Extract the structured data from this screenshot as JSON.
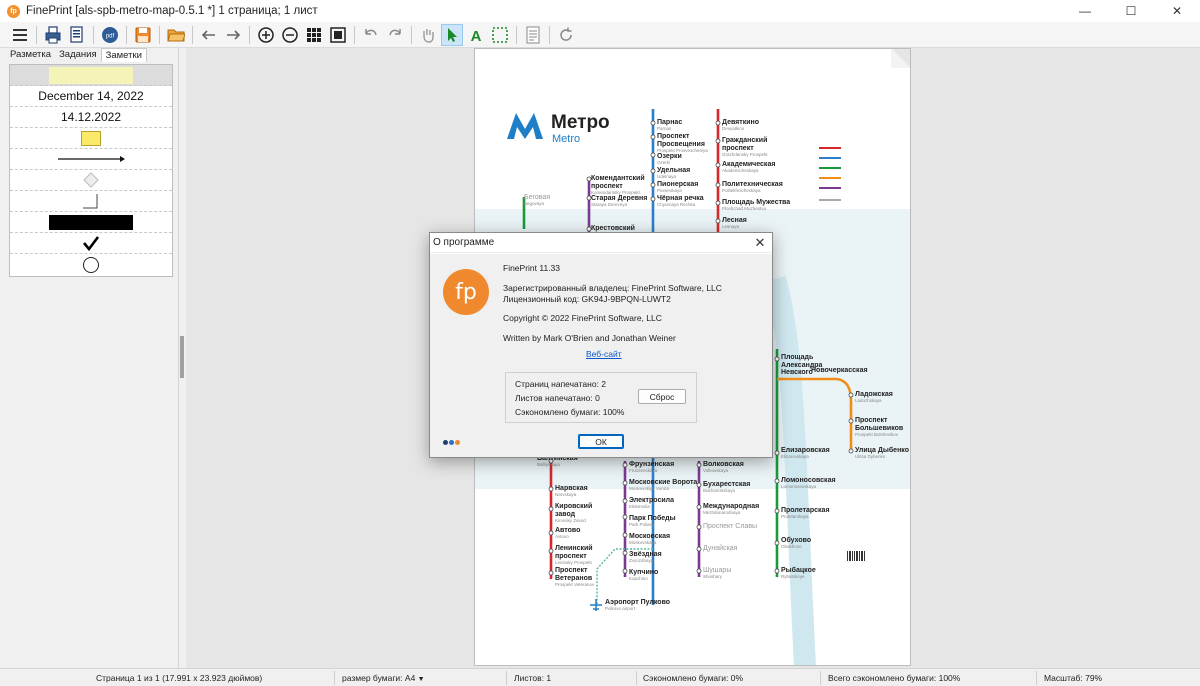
{
  "window": {
    "title": "FinePrint [als-spb-metro-map-0.5.1 *] 1 страница; 1 лист",
    "minimize": "—",
    "maximize": "☐",
    "close": "✕"
  },
  "tabs": [
    "Разметка",
    "Задания",
    "Заметки"
  ],
  "notes": {
    "date_long": "December 14, 2022",
    "date_short": "14.12.2022"
  },
  "map": {
    "title": "Метро",
    "subtitle": "Metro",
    "stations": [
      {
        "ru": "Парнас",
        "en": "Parnas"
      },
      {
        "ru": "Проспект Просвещения",
        "en": "Prospekt Prosvescheniya"
      },
      {
        "ru": "Озерки",
        "en": "Ozerki"
      },
      {
        "ru": "Удельная",
        "en": "Udelnaya"
      },
      {
        "ru": "Пионерская",
        "en": "Pionerskaya"
      },
      {
        "ru": "Чёрная речка",
        "en": "Chyornaya Rechka"
      },
      {
        "ru": "Комендантский проспект",
        "en": "Komendantsky Prospekt"
      },
      {
        "ru": "Старая Деревня",
        "en": "Staraya Derevnya"
      },
      {
        "ru": "Крестовский",
        "en": ""
      },
      {
        "ru": "Беговая",
        "en": "Begovaya"
      },
      {
        "ru": "Девяткино",
        "en": "Devyatkino"
      },
      {
        "ru": "Гражданский проспект",
        "en": "Grazhdansky Prospekt"
      },
      {
        "ru": "Академическая",
        "en": "Akademicheskaya"
      },
      {
        "ru": "Политехническая",
        "en": "Politekhnicheskaya"
      },
      {
        "ru": "Площадь Мужества",
        "en": "Ploshchad Muzhestva"
      },
      {
        "ru": "Лесная",
        "en": "Lesnaya"
      },
      {
        "ru": "Площадь Александра Невского",
        "en": "Ploshchad Aleksandra Nevskogo"
      },
      {
        "ru": "Новочеркасская",
        "en": "Novocherkasskaya"
      },
      {
        "ru": "Ладожская",
        "en": "Ladozhskaya"
      },
      {
        "ru": "Проспект Большевиков",
        "en": "Prospekt Bolshevikov"
      },
      {
        "ru": "Улица Дыбенко",
        "en": "Ulitsa Dybenko"
      },
      {
        "ru": "Елизаровская",
        "en": "Elizarovskaya"
      },
      {
        "ru": "Ломоносовская",
        "en": "Lomonosovskaya"
      },
      {
        "ru": "Пролетарская",
        "en": "Proletarskaya"
      },
      {
        "ru": "Обухово",
        "en": "Obukhovo"
      },
      {
        "ru": "Рыбацкое",
        "en": "Rybatskoye"
      },
      {
        "ru": "Балтийская",
        "en": "Baltiyskaya"
      },
      {
        "ru": "Нарвская",
        "en": "Narvskaya"
      },
      {
        "ru": "Кировский завод",
        "en": "Kirovsky Zavod"
      },
      {
        "ru": "Автово",
        "en": "Avtovo"
      },
      {
        "ru": "Ленинский проспект",
        "en": "Leninsky Prospekt"
      },
      {
        "ru": "Проспект Ветеранов",
        "en": "Prospekt Veteranov"
      },
      {
        "ru": "Фрунзенская",
        "en": "Frunzenskaya"
      },
      {
        "ru": "Московские Ворота",
        "en": "Moskovskiye Vorota"
      },
      {
        "ru": "Электросила",
        "en": "Elektrosila"
      },
      {
        "ru": "Парк Победы",
        "en": "Park Pobedy"
      },
      {
        "ru": "Московская",
        "en": "Moskovskaya"
      },
      {
        "ru": "Звёздная",
        "en": "Zvyozdnaya"
      },
      {
        "ru": "Купчино",
        "en": "Kupchino"
      },
      {
        "ru": "Волковская",
        "en": "Volkovskaya"
      },
      {
        "ru": "Бухарестская",
        "en": "Bukharestskaya"
      },
      {
        "ru": "Международная",
        "en": "Mezhdunarodnaya"
      },
      {
        "ru": "Проспект Славы",
        "en": ""
      },
      {
        "ru": "Дунайская",
        "en": ""
      },
      {
        "ru": "Шушары",
        "en": "Shushary"
      },
      {
        "ru": "Аэропорт Пулково",
        "en": "Pulkovo airport"
      }
    ]
  },
  "dialog": {
    "title": "О программе",
    "close": "✕",
    "logo": "fp",
    "product": "FinePrint 11.33",
    "owner": "Зарегистрированный владелец:  FinePrint Software, LLC",
    "license": "Лицензионный код:  GK94J-9BPQN-LUWT2",
    "copyright": "Copyright © 2022 FinePrint Software, LLC",
    "authors": "Written by Mark O'Brien and Jonathan Weiner",
    "website": "Веб-сайт",
    "pages_printed": "Страниц напечатано: 2",
    "sheets_printed": "Листов напечатано:     0",
    "paper_saved": "Сэкономлено бумаги: 100%",
    "reset": "Сброс",
    "ok": "ОК"
  },
  "status": {
    "page": "Страница 1 из 1 (17.991 x 23.923 дюймов)",
    "paper_size": "размер бумаги: A4",
    "sheets": "Листов: 1",
    "saved": "Сэкономлено бумаги: 0%",
    "total_saved": "Всего сэкономлено бумаги: 100%",
    "zoom": "Масштаб: 79%"
  },
  "colors": {
    "accent": "#f0892e",
    "line_red": "#d6282b",
    "line_blue": "#2c7fc6",
    "line_green": "#1a9a3a",
    "line_orange": "#f28c18",
    "line_purple": "#7b3a91",
    "link": "#0b57d0"
  }
}
